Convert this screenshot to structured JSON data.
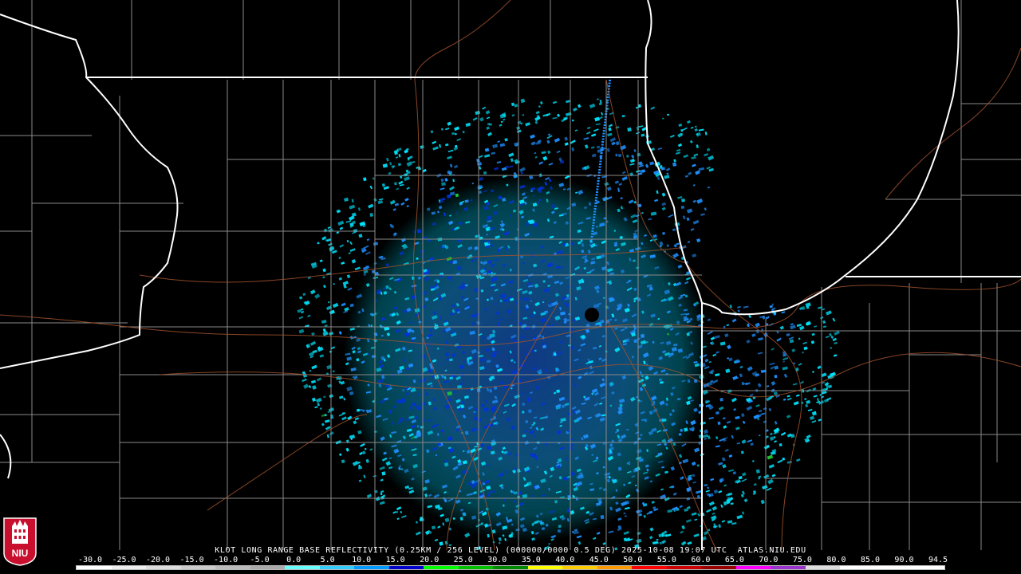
{
  "product": {
    "caption": "KLOT LONG RANGE BASE REFLECTIVITY (0.25KM / 256 LEVEL) (000000/0000 0.5 DEG) 2025-10-08 19:07 UTC  ATLAS.NIU.EDU"
  },
  "colorbar": {
    "labels": [
      "-30.0",
      "-25.0",
      "-20.0",
      "-15.0",
      "-10.0",
      "-5.0",
      "0.0",
      "5.0",
      "10.0",
      "15.0",
      "20.0",
      "25.0",
      "30.0",
      "35.0",
      "40.0",
      "45.0",
      "50.0",
      "55.0",
      "60.0",
      "65.0",
      "70.0",
      "75.0",
      "80.0",
      "85.0",
      "90.0",
      "94.5"
    ],
    "colors": [
      "#ffffff",
      "#eeeeee",
      "#dddddd",
      "#cccccc",
      "#bbbbbb",
      "#aaaaaa",
      "#66ffff",
      "#33ccff",
      "#0099ff",
      "#0000cc",
      "#00ff00",
      "#00c000",
      "#008800",
      "#ffff00",
      "#ffcc00",
      "#ff9900",
      "#ff0000",
      "#cc0000",
      "#990000",
      "#ff00ff",
      "#9933cc",
      "#dddddd",
      "#ffffff",
      "#ffffff",
      "#ffffff"
    ]
  },
  "logo": {
    "text": "NIU",
    "color": "#c8102e"
  },
  "map_colors": {
    "background": "#000000",
    "state_border": "#ffffff",
    "county_border": "#8a8a8a",
    "highway": "#a0522d"
  },
  "radar_colors": {
    "weak": "#00e5ff",
    "moderate": "#1e90ff",
    "strong": "#0033dd",
    "green": "#22cc33"
  }
}
